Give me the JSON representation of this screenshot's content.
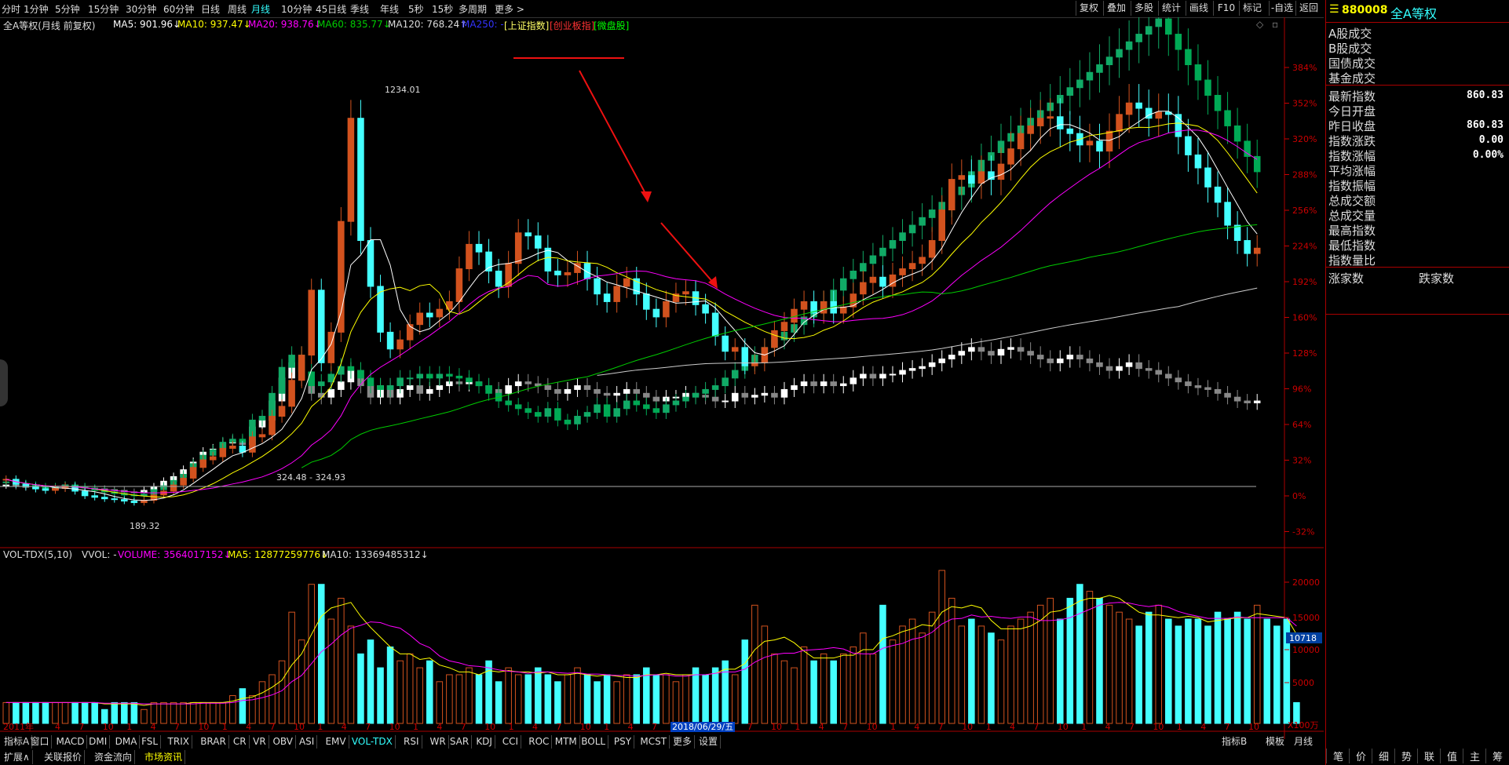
{
  "toolbar": {
    "timeframes": [
      "分时",
      "1分钟",
      "5分钟",
      "15分钟",
      "30分钟",
      "60分钟",
      "日线",
      "周线",
      "月线",
      "10分钟",
      "45日线",
      "季线",
      "年线",
      "5秒",
      "15秒",
      "多周期",
      "更多 >"
    ],
    "active": "月线",
    "right_buttons": [
      "复权",
      "叠加",
      "多股",
      "统计",
      "画线",
      "F10",
      "标记",
      "-自选",
      "返回"
    ]
  },
  "ma_line": {
    "title": "全A等权(月线 前复权)",
    "ma5": "MA5: 901.96↓",
    "ma10": "MA10: 937.47↓",
    "ma20": "MA20: 938.76↓",
    "ma60": "MA60: 835.77↓",
    "ma120": "MA120: 768.24↑",
    "ma250": "MA250: -",
    "index_links": [
      "[上证指数]",
      "[创业板指]",
      "[微盘股]"
    ]
  },
  "colors": {
    "up": "#d2521e",
    "down": "#4ff",
    "ma5": "#fff",
    "ma10": "#ff0",
    "ma20": "#f0f",
    "ma60": "#0c0",
    "ma120": "#ccc",
    "grid": "#a00",
    "axis": "#c00"
  },
  "price_axis": [
    "384%",
    "352%",
    "320%",
    "288%",
    "256%",
    "224%",
    "192%",
    "160%",
    "128%",
    "96%",
    "64%",
    "32%",
    "0%",
    "-32%"
  ],
  "annotations": {
    "high": "1234.01",
    "low": "189.32",
    "base": "324.48 - 324.93"
  },
  "vol_line": {
    "name": "VOL-TDX(5,10)",
    "vvol": "VVOL: -",
    "volume": "VOLUME: 3564017152↓",
    "ma5": "MA5: 12877259776↓",
    "ma10": "MA10: 13369485312↓"
  },
  "vol_axis": [
    "20000",
    "15000",
    "10000",
    "5000"
  ],
  "vol_marker": "10718",
  "vol_unit": "X100万",
  "date_axis": {
    "start": "2011年",
    "highlight": "2018/06/29/五",
    "period": "月线"
  },
  "x_ticks": [
    "4",
    "7",
    "10",
    "1",
    "4",
    "7",
    "10",
    "1",
    "4",
    "7",
    "10",
    "1",
    "4",
    "7",
    "10",
    "1",
    "4",
    "7",
    "10",
    "1",
    "4",
    "7",
    "10",
    "1",
    "4",
    "7",
    "10",
    "1",
    "4",
    "7",
    "10",
    "1",
    "4",
    "7",
    "10",
    "1",
    "4",
    "7",
    "10",
    "1",
    "4",
    "7",
    "10",
    "1",
    "4",
    "7",
    "10",
    "1",
    "4",
    "7",
    "10",
    "1"
  ],
  "indicator_tabs": [
    "指标A",
    "窗口",
    "MACD",
    "DMI",
    "DMA",
    "FSL",
    "TRIX",
    "BRAR",
    "CR",
    "VR",
    "OBV",
    "ASI",
    "EMV",
    "VOL-TDX",
    "RSI",
    "WR",
    "SAR",
    "KDJ",
    "CCI",
    "ROC",
    "MTM",
    "BOLL",
    "PSY",
    "MCST",
    "更多",
    "设置"
  ],
  "active_indicator": "VOL-TDX",
  "indicator_right": [
    "指标B",
    "模板"
  ],
  "bottom_tabs": [
    "扩展∧",
    "关联报价",
    "资金流向",
    "市场资讯"
  ],
  "right_panel": {
    "code": "880008",
    "name": "全A等权",
    "rows_top": [
      "A股成交",
      "B股成交",
      "国债成交",
      "基金成交"
    ],
    "rows": [
      {
        "label": "最新指数",
        "value": "860.83"
      },
      {
        "label": "今日开盘",
        "value": ""
      },
      {
        "label": "昨日收盘",
        "value": "860.83"
      },
      {
        "label": "指数涨跌",
        "value": "0.00"
      },
      {
        "label": "指数涨幅",
        "value": "0.00%"
      },
      {
        "label": "平均涨幅",
        "value": ""
      },
      {
        "label": "指数振幅",
        "value": ""
      },
      {
        "label": "总成交额",
        "value": ""
      },
      {
        "label": "总成交量",
        "value": ""
      },
      {
        "label": "最高指数",
        "value": ""
      },
      {
        "label": "最低指数",
        "value": ""
      },
      {
        "label": "指数量比",
        "value": ""
      }
    ],
    "up_label": "涨家数",
    "down_label": "跌家数",
    "bottom_tabs": [
      "笔",
      "价",
      "细",
      "势",
      "联",
      "值",
      "主",
      "筹"
    ]
  },
  "chart_data": {
    "type": "candlestick",
    "series": [
      {
        "name": "全A等权",
        "prices": [
          255,
          242,
          236,
          230,
          226,
          231,
          237,
          224,
          212,
          208,
          204,
          202,
          198,
          194,
          200,
          214,
          224,
          240,
          258,
          286,
          306,
          314,
          336,
          342,
          326,
          366,
          372,
          420,
          446,
          514,
          580,
          750,
          560,
          640,
          930,
          1200,
          880,
          760,
          640,
          596,
          620,
          660,
          690,
          680,
          700,
          720,
          806,
          870,
          850,
          800,
          760,
          820,
          900,
          892,
          860,
          800,
          790,
          796,
          820,
          780,
          740,
          720,
          760,
          780,
          740,
          700,
          680,
          720,
          740,
          746,
          712,
          690,
          630,
          590,
          600,
          552,
          560,
          600,
          644,
          666,
          700,
          720,
          690,
          720,
          690,
          706,
          740,
          770,
          784,
          760,
          790,
          806,
          820,
          836,
          880,
          960,
          1040,
          1050,
          1030,
          1060,
          1040,
          1080,
          1120,
          1160,
          1180,
          1200,
          1204,
          1172,
          1160,
          1130,
          1140,
          1114,
          1166,
          1210,
          1240,
          1226,
          1200,
          1216,
          1210,
          1152,
          1104,
          1070,
          1020,
          980,
          920,
          880,
          846,
          860
        ]
      },
      {
        "name": "指数(灰)",
        "prices": [
          240,
          238,
          234,
          230,
          228,
          232,
          240,
          236,
          232,
          230,
          228,
          226,
          222,
          220,
          226,
          236,
          250,
          262,
          280,
          300,
          326,
          334,
          350,
          356,
          346,
          392,
          410,
          460,
          520,
          560,
          520,
          480,
          470,
          490,
          510,
          540,
          500,
          470,
          500,
          470,
          490,
          500,
          480,
          490,
          500,
          510,
          505,
          510,
          500,
          490,
          480,
          500,
          510,
          505,
          500,
          490,
          480,
          490,
          500,
          490,
          480,
          475,
          480,
          490,
          480,
          470,
          460,
          470,
          470,
          480,
          475,
          470,
          460,
          460,
          480,
          470,
          475,
          480,
          470,
          490,
          500,
          510,
          500,
          510,
          500,
          505,
          520,
          530,
          520,
          530,
          530,
          540,
          545,
          550,
          560,
          570,
          580,
          590,
          600,
          590,
          580,
          595,
          600,
          590,
          580,
          570,
          560,
          570,
          580,
          570,
          560,
          550,
          540,
          550,
          560,
          545,
          540,
          530,
          520,
          510,
          500,
          495,
          490,
          480,
          470,
          460,
          455,
          460
        ]
      },
      {
        "name": "绿线",
        "prices": [
          248,
          244,
          240,
          236,
          232,
          236,
          240,
          236,
          232,
          226,
          222,
          218,
          214,
          212,
          216,
          228,
          238,
          252,
          268,
          296,
          318,
          332,
          352,
          360,
          352,
          410,
          420,
          480,
          548,
          580,
          536,
          500,
          510,
          530,
          550,
          540,
          520,
          500,
          490,
          500,
          520,
          520,
          530,
          520,
          530,
          525,
          520,
          510,
          500,
          480,
          460,
          450,
          440,
          430,
          420,
          440,
          410,
          400,
          420,
          430,
          450,
          420,
          440,
          460,
          450,
          440,
          430,
          450,
          460,
          470,
          480,
          490,
          500,
          520,
          540,
          560,
          580,
          600,
          620,
          640,
          660,
          680,
          700,
          720,
          750,
          780,
          800,
          820,
          840,
          860,
          880,
          900,
          920,
          940,
          960,
          980,
          1000,
          1020,
          1060,
          1090,
          1110,
          1140,
          1160,
          1180,
          1200,
          1220,
          1240,
          1260,
          1280,
          1300,
          1320,
          1340,
          1360,
          1380,
          1400,
          1420,
          1440,
          1460,
          1420,
          1380,
          1340,
          1300,
          1260,
          1220,
          1180,
          1140,
          1100,
          1060,
          1020,
          980,
          940,
          900
        ]
      }
    ],
    "volume_bars": [
      3,
      3,
      3,
      3,
      3,
      3,
      3,
      3,
      3,
      3,
      2,
      3,
      3,
      3,
      2,
      3,
      3,
      3,
      3,
      3,
      3,
      3,
      3,
      4,
      5,
      4,
      6,
      7,
      9,
      16,
      12,
      20,
      20,
      15,
      18,
      14,
      10,
      12,
      8,
      11,
      9,
      10,
      8,
      9,
      6,
      7,
      7,
      8,
      7,
      9,
      6,
      8,
      7,
      7,
      8,
      7,
      6,
      7,
      8,
      7,
      6,
      7,
      6,
      7,
      7,
      8,
      7,
      7,
      6,
      7,
      8,
      7,
      8,
      9,
      7,
      12,
      17,
      14,
      10,
      9,
      8,
      11,
      9,
      10,
      9,
      10,
      11,
      13,
      10,
      17,
      12,
      14,
      15,
      13,
      16,
      22,
      18,
      14,
      15,
      14,
      13,
      12,
      14,
      15,
      16,
      17,
      18,
      15,
      18,
      20,
      19,
      18,
      17,
      16,
      15,
      14,
      16,
      17,
      15,
      14,
      15,
      15,
      14,
      16,
      15,
      16,
      15,
      17,
      15,
      14,
      15,
      3
    ],
    "price_ylim": [
      -32,
      400
    ],
    "vol_ylim": [
      0,
      22000
    ]
  }
}
